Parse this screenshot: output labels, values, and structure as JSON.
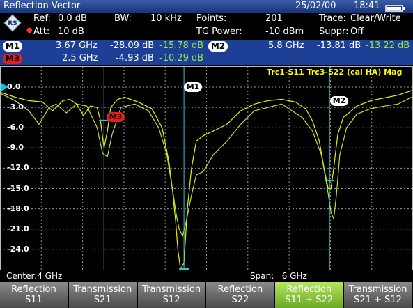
{
  "window": {
    "title": "Reflection Vector",
    "date": "25/02/00",
    "time": "18:41"
  },
  "settings": {
    "ref_label": "Ref:",
    "ref_value": "0.0 dB",
    "att_label": "Att:",
    "att_value": "10 dB",
    "bw_label": "BW:",
    "bw_value": "10 kHz",
    "points_label": "Points:",
    "points_value": "201",
    "tg_label": "TG Power:",
    "tg_value": "-10 dBm",
    "trace_label": "Trace:",
    "trace_value": "Clear/Write",
    "suppr_label": "Suppr:",
    "suppr_value": "Off"
  },
  "markers": [
    {
      "id": "M1",
      "freq": "3.67 GHz",
      "val1": "-28.09 dB",
      "val2": "-15.78 dB",
      "color": "#ffffff"
    },
    {
      "id": "M2",
      "freq": "5.8 GHz",
      "val1": "-13.81 dB",
      "val2": "-13.22 dB",
      "color": "#ffffff"
    },
    {
      "id": "M3",
      "freq": "2.5 GHz",
      "val1": "-4.93 dB",
      "val2": "-10.29 dB",
      "color": "#e02020"
    }
  ],
  "plot": {
    "legend": "Trc1-S11 Trc3-S22 (cal HA) Mag",
    "y_ticks": [
      "0.0",
      "-3.0",
      "-6.0",
      "-9.0",
      "-12.0",
      "-15.0",
      "-18.0",
      "-21.0",
      "-24.0"
    ],
    "marker_labels": [
      "M1",
      "M2",
      "M3"
    ]
  },
  "chart_data": {
    "type": "line",
    "xlabel": "",
    "ylabel": "",
    "xlim": [
      1,
      7
    ],
    "ylim": [
      -27,
      1
    ],
    "y_ticks": [
      0,
      -3,
      -6,
      -9,
      -12,
      -15,
      -18,
      -21,
      -24
    ],
    "series": [
      {
        "name": "Trc1-S11",
        "color": "#f0f000",
        "x": [
          1.0,
          1.2,
          1.4,
          1.6,
          1.75,
          1.9,
          2.0,
          2.1,
          2.2,
          2.3,
          2.4,
          2.45,
          2.5,
          2.55,
          2.6,
          2.7,
          2.8,
          3.0,
          3.2,
          3.35,
          3.45,
          3.5,
          3.55,
          3.58,
          3.62,
          3.67,
          3.72,
          3.78,
          3.85,
          3.95,
          4.1,
          4.3,
          4.5,
          4.7,
          4.9,
          5.1,
          5.3,
          5.45,
          5.55,
          5.65,
          5.72,
          5.78,
          5.82,
          5.86,
          5.92,
          6.0,
          6.2,
          6.4,
          6.6,
          6.8,
          7.0
        ],
        "y": [
          -0.8,
          -1.5,
          -2.0,
          -2.2,
          -3.5,
          -2.0,
          -1.8,
          -2.5,
          -4.2,
          -2.8,
          -3.0,
          -5.0,
          -9.0,
          -6.5,
          -3.0,
          -1.8,
          -1.5,
          -2.2,
          -3.2,
          -6.0,
          -11.0,
          -15.0,
          -20.0,
          -24.0,
          -27.0,
          -26.0,
          -18.0,
          -12.0,
          -8.0,
          -7.2,
          -6.5,
          -5.5,
          -3.5,
          -2.5,
          -2.0,
          -1.8,
          -2.2,
          -3.2,
          -5.0,
          -8.0,
          -12.0,
          -15.0,
          -15.0,
          -12.0,
          -7.0,
          -4.5,
          -2.8,
          -2.0,
          -1.6,
          -1.2,
          -0.5
        ]
      },
      {
        "name": "Trc3-S22",
        "color": "#b9e23a",
        "x": [
          1.0,
          1.2,
          1.4,
          1.55,
          1.7,
          1.8,
          1.95,
          2.1,
          2.25,
          2.4,
          2.48,
          2.55,
          2.62,
          2.75,
          2.95,
          3.15,
          3.3,
          3.42,
          3.5,
          3.56,
          3.6,
          3.65,
          3.7,
          3.78,
          3.85,
          3.95,
          4.1,
          4.3,
          4.5,
          4.7,
          4.9,
          5.1,
          5.25,
          5.4,
          5.55,
          5.68,
          5.76,
          5.82,
          5.86,
          5.9,
          5.95,
          6.05,
          6.2,
          6.4,
          6.6,
          6.8,
          7.0
        ],
        "y": [
          -1.0,
          -2.0,
          -3.5,
          -5.5,
          -3.0,
          -2.5,
          -3.8,
          -2.5,
          -2.8,
          -6.0,
          -9.8,
          -10.3,
          -7.0,
          -3.0,
          -2.5,
          -3.5,
          -6.0,
          -10.0,
          -15.0,
          -19.0,
          -21.0,
          -22.0,
          -20.0,
          -16.0,
          -13.0,
          -12.5,
          -10.0,
          -8.0,
          -5.5,
          -3.5,
          -3.0,
          -2.5,
          -3.5,
          -4.5,
          -6.5,
          -10.0,
          -14.5,
          -18.5,
          -19.5,
          -16.0,
          -10.0,
          -6.0,
          -4.0,
          -3.2,
          -2.8,
          -2.5,
          -1.5
        ]
      }
    ],
    "markers": [
      {
        "name": "M1",
        "x": 3.67,
        "y": -28.09
      },
      {
        "name": "M2",
        "x": 5.8,
        "y": -13.81
      },
      {
        "name": "M3",
        "x": 2.5,
        "y": -4.93
      }
    ]
  },
  "footer": {
    "center_label": "Center:",
    "center_value": "4 GHz",
    "span_label": "Span:",
    "span_value": "6 GHz"
  },
  "softkeys": [
    {
      "line1": "Reflection",
      "line2": "S11",
      "active": false
    },
    {
      "line1": "Transmission",
      "line2": "S21",
      "active": false
    },
    {
      "line1": "Transmission",
      "line2": "S12",
      "active": false
    },
    {
      "line1": "Reflection",
      "line2": "S22",
      "active": false
    },
    {
      "line1": "Reflection",
      "line2": "S11 + S22",
      "active": true
    },
    {
      "line1": "Transmission",
      "line2": "S21 + S12",
      "active": false
    }
  ]
}
